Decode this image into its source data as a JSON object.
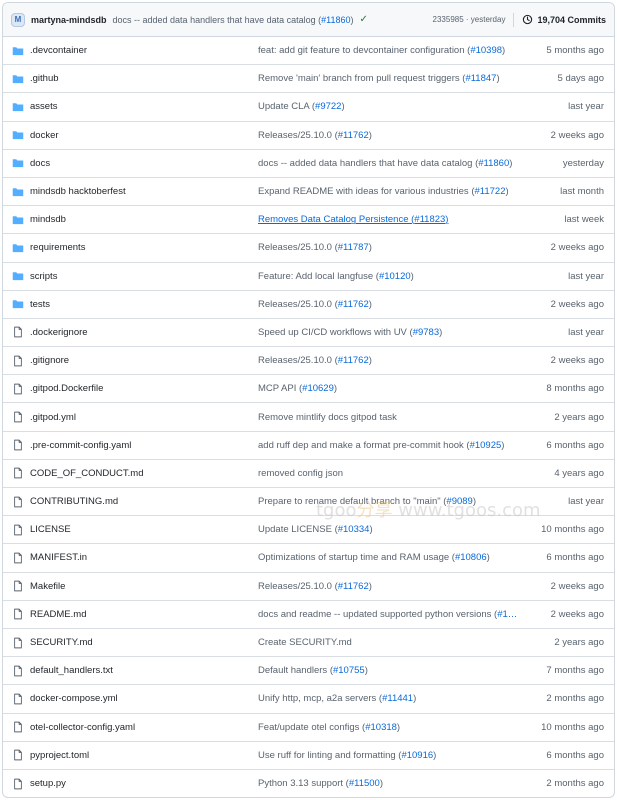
{
  "header": {
    "avatar_letter": "M",
    "author": "martyna-mindsdb",
    "commit_message": "docs -- added data handlers that have data catalog (",
    "commit_pr": "#11860",
    "commit_close": ")",
    "sha_time": "2335985 · yesterday",
    "commits_count": "19,704 Commits"
  },
  "rows": [
    {
      "type": "dir",
      "name": ".devcontainer",
      "msg": "feat: add git feature to devcontainer configuration (",
      "pr": "#10398",
      "close": ")",
      "age": "5 months ago"
    },
    {
      "type": "dir",
      "name": ".github",
      "msg": "Remove 'main' branch from pull request triggers (",
      "pr": "#11847",
      "close": ")",
      "age": "5 days ago"
    },
    {
      "type": "dir",
      "name": "assets",
      "msg": "Update CLA (",
      "pr": "#9722",
      "close": ")",
      "age": "last year"
    },
    {
      "type": "dir",
      "name": "docker",
      "msg": "Releases/25.10.0 (",
      "pr": "#11762",
      "close": ")",
      "age": "2 weeks ago"
    },
    {
      "type": "dir",
      "name": "docs",
      "msg": "docs -- added data handlers that have data catalog (",
      "pr": "#11860",
      "close": ")",
      "age": "yesterday"
    },
    {
      "type": "dir",
      "name": "mindsdb hacktoberfest",
      "msg": "Expand README with ideas for various industries (",
      "pr": "#11722",
      "close": ")",
      "age": "last month"
    },
    {
      "type": "dir",
      "name": "mindsdb",
      "msg": "Removes Data Catalog Persistence (",
      "pr": "#11823",
      "close": ")",
      "age": "last week",
      "link": true
    },
    {
      "type": "dir",
      "name": "requirements",
      "msg": "Releases/25.10.0 (",
      "pr": "#11787",
      "close": ")",
      "age": "2 weeks ago"
    },
    {
      "type": "dir",
      "name": "scripts",
      "msg": "Feature: Add local langfuse (",
      "pr": "#10120",
      "close": ")",
      "age": "last year"
    },
    {
      "type": "dir",
      "name": "tests",
      "msg": "Releases/25.10.0 (",
      "pr": "#11762",
      "close": ")",
      "age": "2 weeks ago"
    },
    {
      "type": "file",
      "name": ".dockerignore",
      "msg": "Speed up CI/CD workflows with UV (",
      "pr": "#9783",
      "close": ")",
      "age": "last year"
    },
    {
      "type": "file",
      "name": ".gitignore",
      "msg": "Releases/25.10.0 (",
      "pr": "#11762",
      "close": ")",
      "age": "2 weeks ago"
    },
    {
      "type": "file",
      "name": ".gitpod.Dockerfile",
      "msg": "MCP API (",
      "pr": "#10629",
      "close": ")",
      "age": "8 months ago"
    },
    {
      "type": "file",
      "name": ".gitpod.yml",
      "msg": "Remove mintlify docs gitpod task",
      "pr": "",
      "close": "",
      "age": "2 years ago"
    },
    {
      "type": "file",
      "name": ".pre-commit-config.yaml",
      "msg": "add ruff dep and make a format pre-commit hook (",
      "pr": "#10925",
      "close": ")",
      "age": "6 months ago"
    },
    {
      "type": "file",
      "name": "CODE_OF_CONDUCT.md",
      "msg": "removed config json",
      "pr": "",
      "close": "",
      "age": "4 years ago"
    },
    {
      "type": "file",
      "name": "CONTRIBUTING.md",
      "msg": "Prepare to rename default branch to \"main\" (",
      "pr": "#9089",
      "close": ")",
      "age": "last year"
    },
    {
      "type": "file",
      "name": "LICENSE",
      "msg": "Update LICENSE (",
      "pr": "#10334",
      "close": ")",
      "age": "10 months ago"
    },
    {
      "type": "file",
      "name": "MANIFEST.in",
      "msg": "Optimizations of startup time and RAM usage (",
      "pr": "#10806",
      "close": ")",
      "age": "6 months ago"
    },
    {
      "type": "file",
      "name": "Makefile",
      "msg": "Releases/25.10.0 (",
      "pr": "#11762",
      "close": ")",
      "age": "2 weeks ago"
    },
    {
      "type": "file",
      "name": "README.md",
      "msg": "docs and readme -- updated supported python versions (",
      "pr": "#1…",
      "close": "",
      "age": "2 weeks ago"
    },
    {
      "type": "file",
      "name": "SECURITY.md",
      "msg": "Create SECURITY.md",
      "pr": "",
      "close": "",
      "age": "2 years ago"
    },
    {
      "type": "file",
      "name": "default_handlers.txt",
      "msg": "Default handlers (",
      "pr": "#10755",
      "close": ")",
      "age": "7 months ago"
    },
    {
      "type": "file",
      "name": "docker-compose.yml",
      "msg": "Unify http, mcp, a2a servers (",
      "pr": "#11441",
      "close": ")",
      "age": "2 months ago"
    },
    {
      "type": "file",
      "name": "otel-collector-config.yaml",
      "msg": "Feat/update otel configs (",
      "pr": "#10318",
      "close": ")",
      "age": "10 months ago"
    },
    {
      "type": "file",
      "name": "pyproject.toml",
      "msg": "Use ruff for linting and formatting (",
      "pr": "#10916",
      "close": ")",
      "age": "6 months ago"
    },
    {
      "type": "file",
      "name": "setup.py",
      "msg": "Python 3.13 support (",
      "pr": "#11500",
      "close": ")",
      "age": "2 months ago"
    }
  ],
  "watermark": {
    "latin": "tgoo",
    "cjk": "分享",
    "url": "www.tgoos.com"
  },
  "colors": {
    "folder": "#54aeff",
    "file": "#59636e",
    "link": "#0969da",
    "check": "#1a7f37"
  },
  "icons": {
    "dir": "folder-icon",
    "file": "file-icon",
    "commits": "history-icon",
    "status": "check-icon"
  }
}
